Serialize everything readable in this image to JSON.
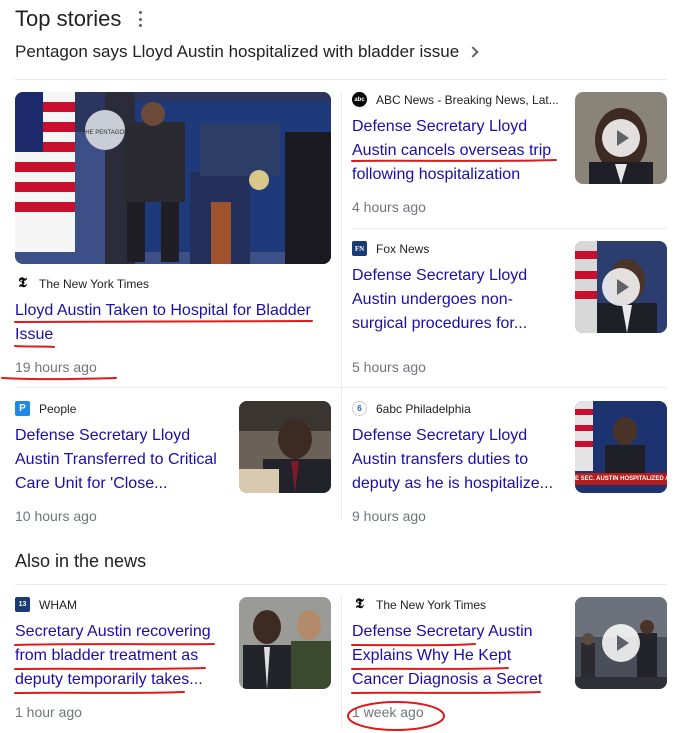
{
  "header": {
    "title": "Top stories"
  },
  "headline": {
    "text": "Pentagon says Lloyd Austin hospitalized with bladder issue"
  },
  "stories": [
    {
      "source": "The New York Times",
      "title_lines": [
        "Lloyd Austin Taken to Hospital for Bladder",
        "Issue"
      ],
      "time": "19 hours ago"
    },
    {
      "source": "ABC News - Breaking News, Lat...",
      "title_lines": [
        "Defense Secretary Lloyd",
        "Austin cancels overseas trip",
        "following hospitalization"
      ],
      "time": "4 hours ago"
    },
    {
      "source": "Fox News",
      "title_lines": [
        "Defense Secretary Lloyd",
        "Austin undergoes non-",
        "surgical procedures for..."
      ],
      "time": "5 hours ago"
    },
    {
      "source": "People",
      "title_lines": [
        "Defense Secretary Lloyd",
        "Austin Transferred to Critical",
        "Care Unit for 'Close..."
      ],
      "time": "10 hours ago"
    },
    {
      "source": "6abc Philadelphia",
      "title_lines": [
        "Defense Secretary Lloyd",
        "Austin transfers duties to",
        "deputy as he is hospitalize..."
      ],
      "time": "9 hours ago",
      "thumb_caption": "E SEC. AUSTIN HOSPITALIZED A"
    }
  ],
  "also": {
    "title": "Also in the news",
    "stories": [
      {
        "source": "WHAM",
        "title_lines": [
          "Secretary Austin recovering",
          "from bladder treatment as",
          "deputy temporarily takes..."
        ],
        "time": "1 hour ago"
      },
      {
        "source": "The New York Times",
        "title_lines": [
          "Defense Secretary Austin",
          "Explains Why He Kept",
          "Cancer Diagnosis a Secret"
        ],
        "time": "1 week ago"
      }
    ]
  },
  "colors": {
    "link": "#1a0dab",
    "annotation": "#e01a1a",
    "meta": "#70757a"
  }
}
